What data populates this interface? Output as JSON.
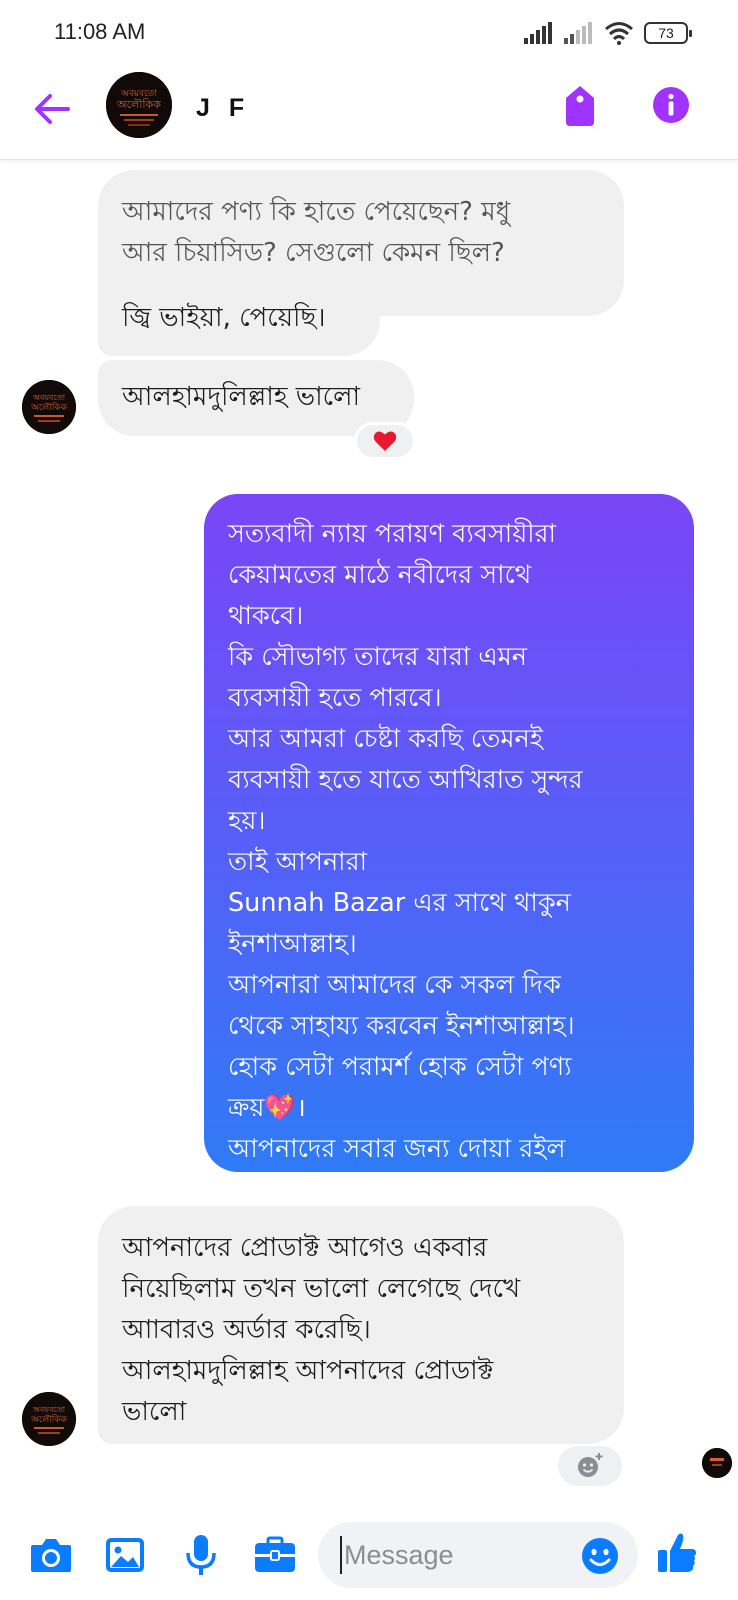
{
  "status_bar": {
    "time": "11:08 AM",
    "battery": "73"
  },
  "header": {
    "contact_name": "J F"
  },
  "messages": {
    "m1": [
      "আমাদের পণ্য কি হাতে পেয়েছেন?  মধু",
      "আর চিয়াসিড?  সেগুলো কেমন ছিল?"
    ],
    "m2": "জ্বি ভাইয়া, পেয়েছি।",
    "m3": "আলহামদুলিল্লাহ ভালো",
    "m3_reaction": "heart",
    "m4": [
      "সত্যবাদী ন্যায় পরায়ণ ব্যবসায়ীরা",
      "কেয়ামতের মাঠে নবীদের সাথে",
      "থাকবে।",
      "কি সৌভাগ্য তাদের যারা এমন",
      "ব্যবসায়ী হতে পারবে।",
      "আর আমরা চেষ্টা করছি তেমনই",
      "ব্যবসায়ী হতে যাতে আখিরাত সুন্দর",
      "হয়।",
      "তাই আপনারা",
      "Sunnah Bazar  এর সাথে থাকুন",
      "ইনশাআল্লাহ।",
      "আপনারা আমাদের কে সকল দিক",
      "থেকে সাহায্য করবেন ইনশাআল্লাহ।",
      "হোক সেটা পরামর্শ হোক সেটা পণ্য",
      "ক্রয়💖।",
      "আপনাদের সবার জন্য দোয়া রইল"
    ],
    "m5": [
      "আপনাদের প্রোডাক্ট আগেও একবার",
      "নিয়েছিলাম তখন ভালো লেগেছে দেখে",
      "আাবারও অর্ডার করেছি।",
      "আলহামদুলিল্লাহ আপনাদের প্রোডাক্ট",
      "ভালো"
    ]
  },
  "composer": {
    "placeholder": "Message"
  },
  "colors": {
    "accent": "#a033ff",
    "messenger_blue": "#0a7cff",
    "bubble_incoming": "#f0f0f0",
    "gradient_top": "#7a46f6",
    "gradient_bottom": "#2f7bf6"
  },
  "icons": {
    "back": "back-arrow-icon",
    "tag": "tag-icon",
    "info": "info-icon",
    "camera": "camera-icon",
    "gallery": "gallery-icon",
    "mic": "microphone-icon",
    "briefcase": "briefcase-icon",
    "emoji": "emoji-icon",
    "like": "thumbs-up-icon"
  }
}
